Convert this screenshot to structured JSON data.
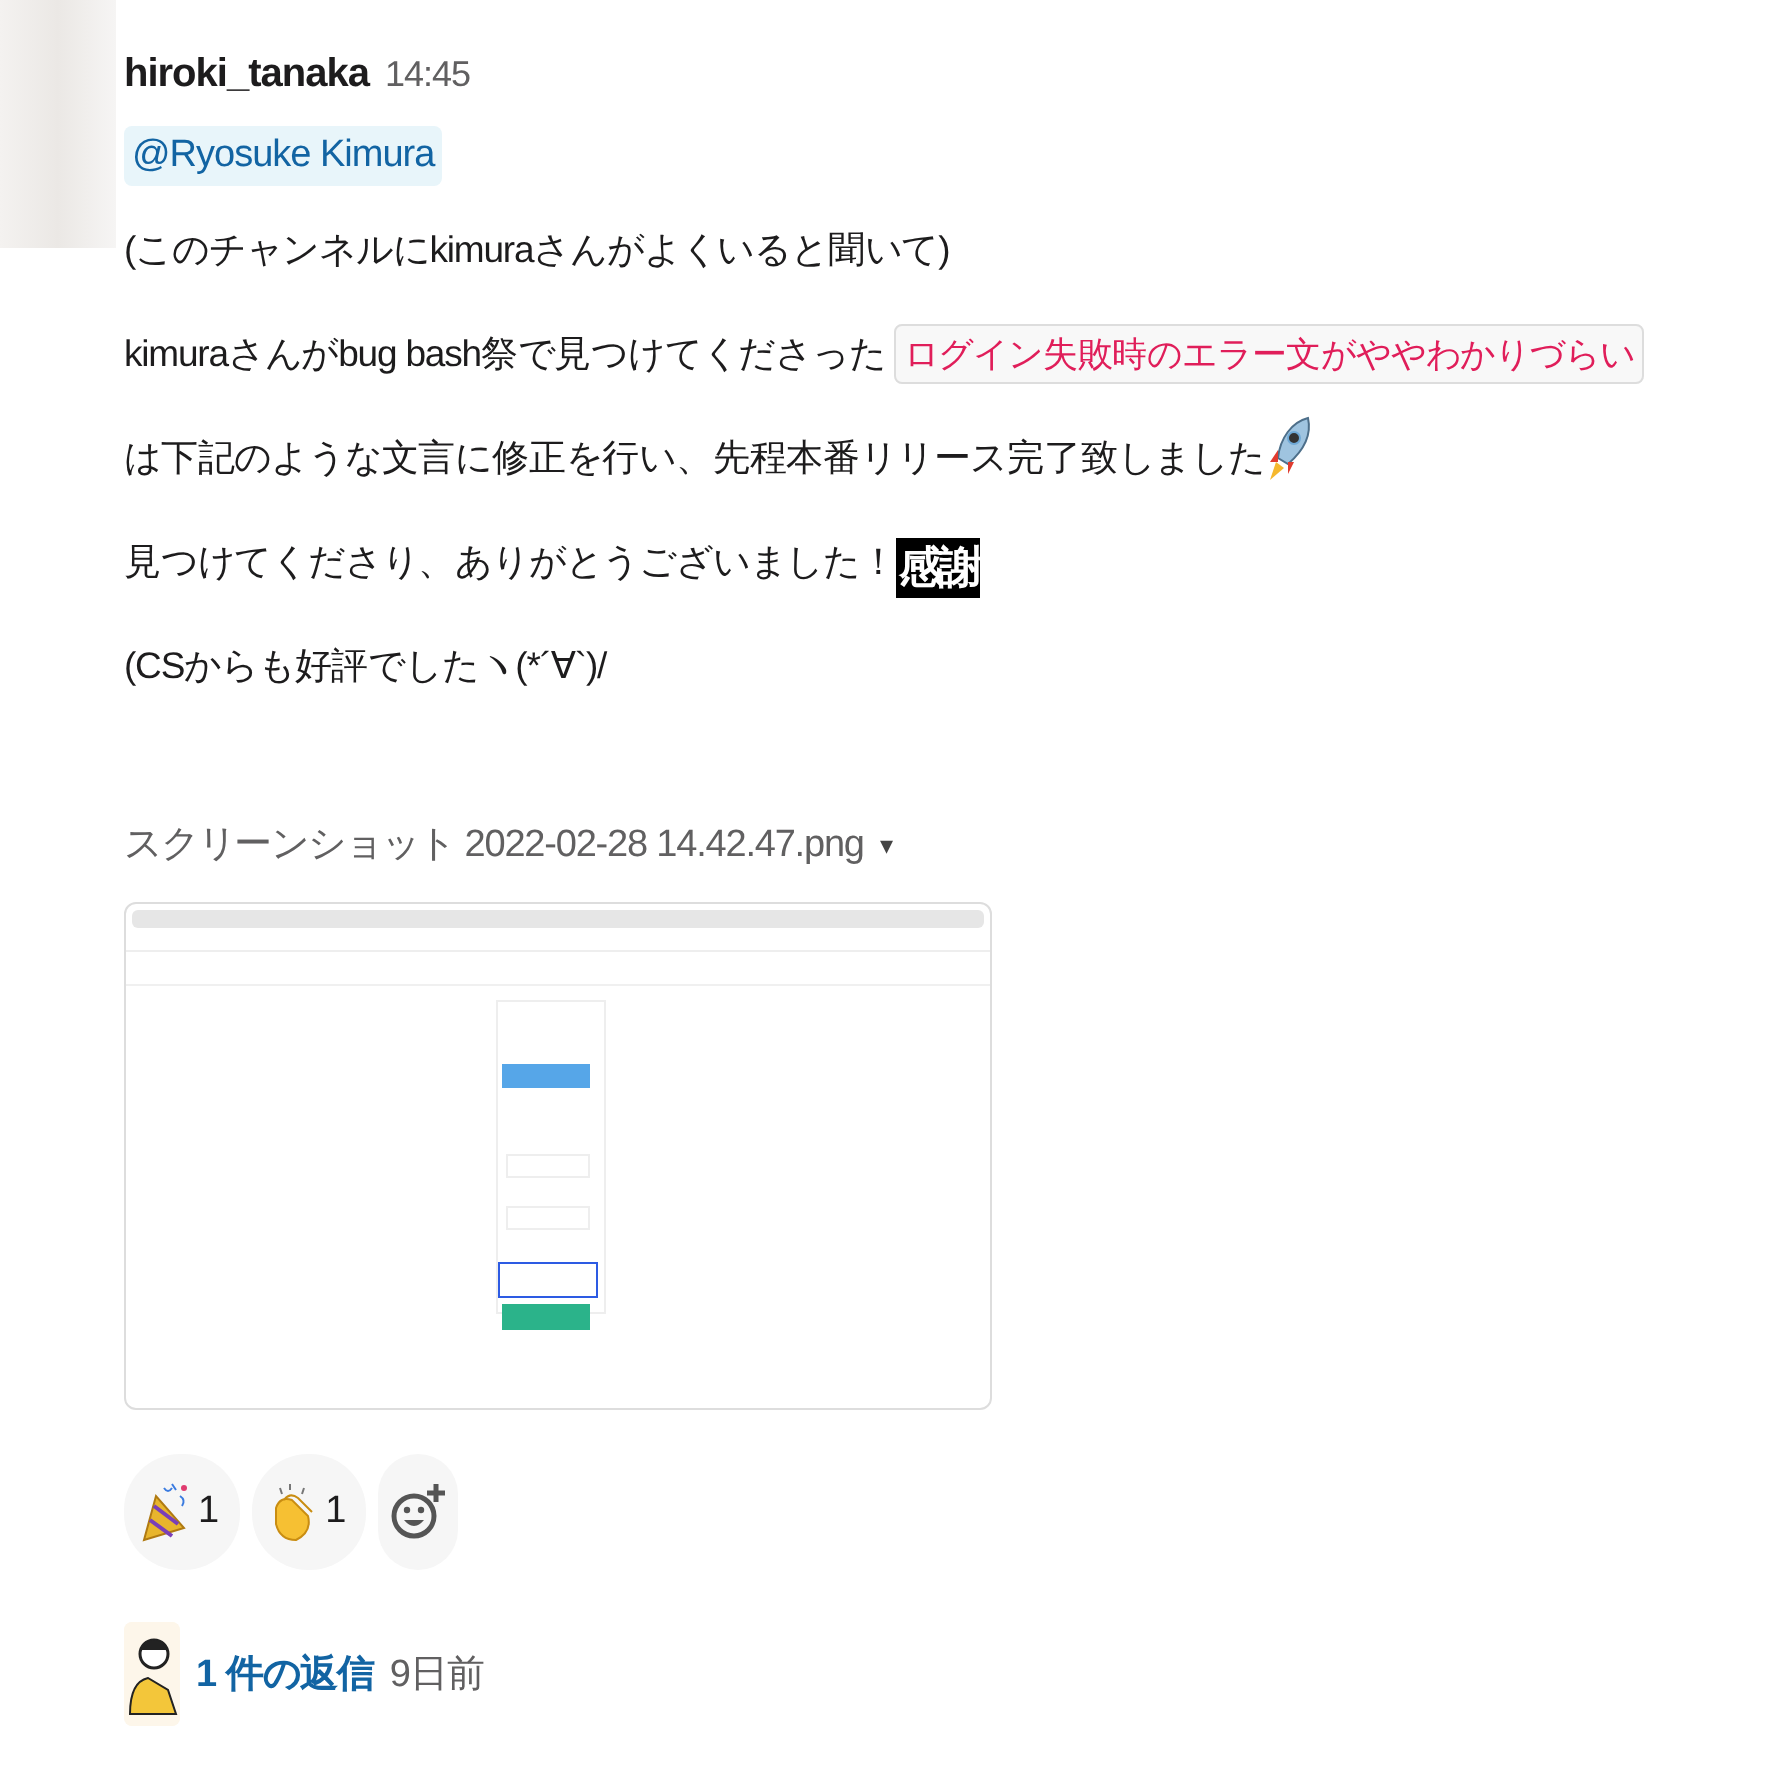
{
  "message": {
    "author": "hiroki_tanaka",
    "time": "14:45",
    "mention": "@Ryosuke Kimura",
    "paragraphs": [
      {
        "segments": [
          {
            "kind": "text",
            "text": "(このチャンネルにkimuraさんがよくいると聞いて)"
          }
        ]
      },
      {
        "segments": [
          {
            "kind": "text",
            "text": "kimuraさんがbug bash祭で見つけてくださった"
          },
          {
            "kind": "code",
            "text": "ログイン失敗時のエラー文がややわかりづらい"
          },
          {
            "kind": "text",
            "text": "は下記のような文"
          },
          {
            "kind": "text",
            "text": "言に修正を行い、先程本番リリース完了致しました"
          },
          {
            "kind": "rocket"
          }
        ]
      },
      {
        "segments": [
          {
            "kind": "text",
            "text": "見つけてくださり、ありがとうございました！"
          },
          {
            "kind": "stamp",
            "text": "感謝"
          }
        ]
      },
      {
        "segments": [
          {
            "kind": "text",
            "text": "(CSからも好評でしたヽ(*´∀`)/"
          }
        ]
      }
    ],
    "file": {
      "name": "スクリーンショット 2022-02-28 14.42.47.png",
      "caret": "▾"
    },
    "reactions": [
      {
        "kind": "party",
        "count": "1"
      },
      {
        "kind": "clap",
        "count": "1"
      }
    ],
    "thread": {
      "replies": "1 件の返信",
      "ago": "9日前"
    }
  }
}
